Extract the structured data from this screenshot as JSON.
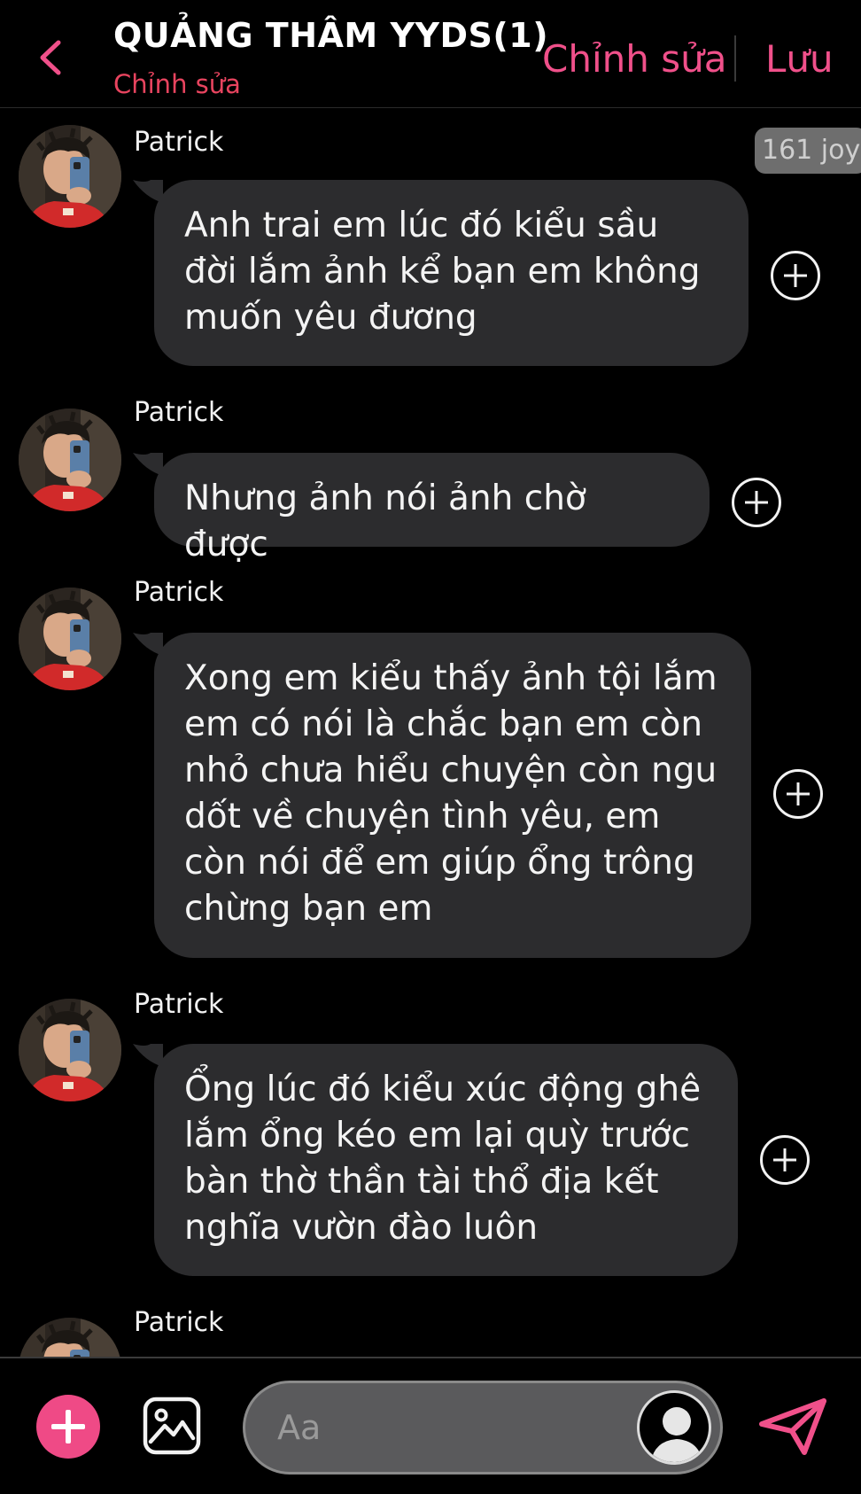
{
  "header": {
    "title": "QUẢNG THÂM YYDS(1)",
    "subtitle": "Chỉnh sửa",
    "edit_label": "Chỉnh sửa",
    "save_label": "Lưu"
  },
  "messages": [
    {
      "sender": "Patrick",
      "text": "Anh trai em lúc đó kiểu sầu đời lắm ảnh kể bạn em không muốn yêu đương",
      "badge": "161 joy"
    },
    {
      "sender": "Patrick",
      "text": "Nhưng ảnh nói ảnh chờ được"
    },
    {
      "sender": "Patrick",
      "text": "Xong em kiểu thấy ảnh tội lắm em có nói là chắc bạn em còn nhỏ chưa hiểu chuyện còn ngu dốt về chuyện tình yêu, em còn nói để em giúp ổng trông chừng bạn em"
    },
    {
      "sender": "Patrick",
      "text": "Ổng lúc đó kiểu xúc động ghê lắm ổng kéo em lại quỳ trước bàn thờ thần tài thổ địa kết nghĩa vườn đào luôn"
    },
    {
      "sender": "Patrick"
    }
  ],
  "composer": {
    "placeholder": "Aa"
  },
  "colors": {
    "accent": "#f0508a",
    "subtitle": "#e8445f",
    "bubble": "#2c2c2e",
    "background": "#000000"
  },
  "icons": {
    "back": "chevron-left-icon",
    "react": "plus-circle-icon",
    "add": "plus-icon",
    "photo": "image-icon",
    "send": "send-icon"
  }
}
